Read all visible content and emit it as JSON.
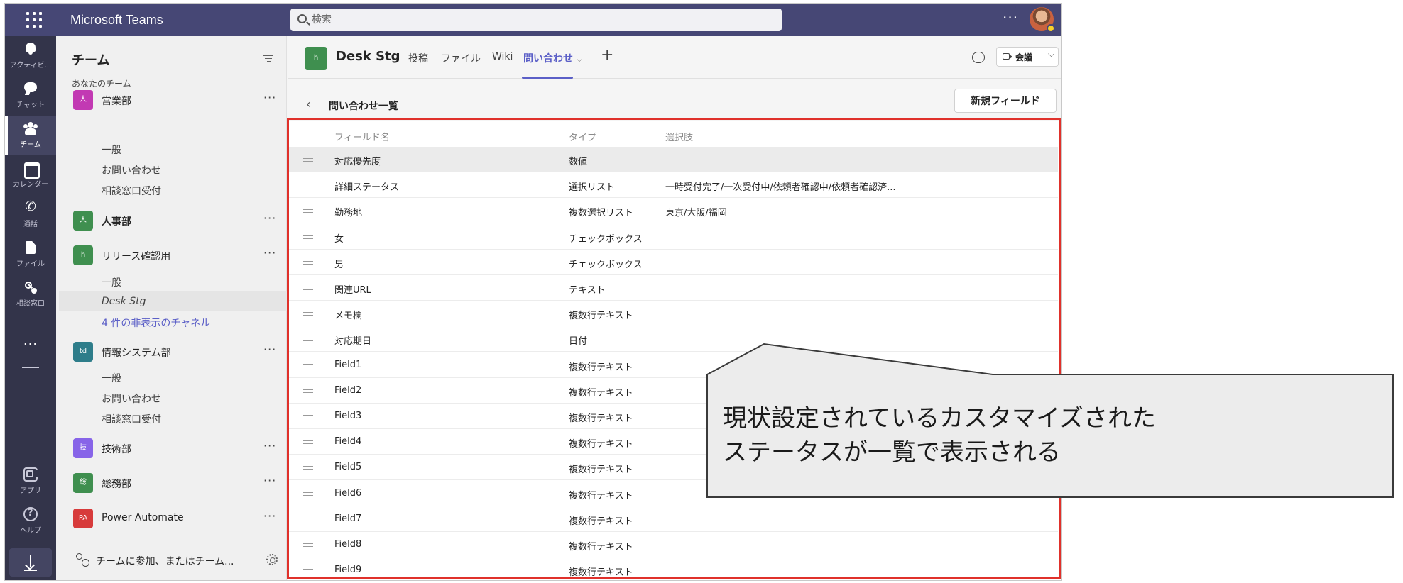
{
  "app": {
    "title": "Microsoft Teams",
    "search_placeholder": "検索",
    "more": "···"
  },
  "rail": {
    "items": [
      {
        "label": "アクティビ..."
      },
      {
        "label": "チャット"
      },
      {
        "label": "チーム"
      },
      {
        "label": "カレンダー"
      },
      {
        "label": "通話"
      },
      {
        "label": "ファイル"
      },
      {
        "label": "相談窓口"
      }
    ],
    "more": "···",
    "apps_label": "アプリ",
    "help_label": "ヘルプ"
  },
  "panel": {
    "title": "チーム",
    "section_label": "あなたのチーム",
    "teams": [
      {
        "tile": "人",
        "color": "#c239b3",
        "name": "営業部",
        "channels": [
          "一般",
          "お問い合わせ",
          "相談窓口受付"
        ]
      },
      {
        "tile": "人",
        "color": "#3f8f4f",
        "name": "人事部",
        "channels": []
      },
      {
        "tile": "h",
        "color": "#3f8f4f",
        "name": "リリース確認用",
        "channels": [
          "一般",
          "Desk Stg"
        ],
        "hidden_channels": "4 件の非表示のチャネル"
      },
      {
        "tile": "td",
        "color": "#2e7d8a",
        "name": "情報システム部",
        "channels": [
          "一般",
          "お問い合わせ",
          "相談窓口受付"
        ]
      },
      {
        "tile": "技",
        "color": "#8764e8",
        "name": "技術部",
        "channels": []
      },
      {
        "tile": "総",
        "color": "#3f8f4f",
        "name": "総務部",
        "channels": []
      },
      {
        "tile": "PA",
        "color": "#d73b3b",
        "name": "Power Automate",
        "channels": []
      }
    ],
    "dots": "···",
    "join_label": "チームに参加、またはチーム..."
  },
  "channel": {
    "tile": "h",
    "title": "Desk Stg",
    "tabs": [
      "投稿",
      "ファイル",
      "Wiki",
      "問い合わせ"
    ],
    "active_tab_chevron": "⌵",
    "add_tab": "+",
    "meet_label": "会議",
    "meet_chevron": "⌵"
  },
  "inquiry": {
    "back": "‹",
    "title": "問い合わせ一覧",
    "new_field_label": "新規フィールド",
    "columns": [
      "フィールド名",
      "タイプ",
      "選択肢"
    ],
    "rows": [
      {
        "name": "対応優先度",
        "type": "数値",
        "options": ""
      },
      {
        "name": "詳細ステータス",
        "type": "選択リスト",
        "options": "一時受付完了/一次受付中/依頼者確認中/依頼者確認済..."
      },
      {
        "name": "勤務地",
        "type": "複数選択リスト",
        "options": "東京/大阪/福岡"
      },
      {
        "name": "女",
        "type": "チェックボックス",
        "options": ""
      },
      {
        "name": "男",
        "type": "チェックボックス",
        "options": ""
      },
      {
        "name": "関連URL",
        "type": "テキスト",
        "options": ""
      },
      {
        "name": "メモ欄",
        "type": "複数行テキスト",
        "options": ""
      },
      {
        "name": "対応期日",
        "type": "日付",
        "options": ""
      },
      {
        "name": "Field1",
        "type": "複数行テキスト",
        "options": ""
      },
      {
        "name": "Field2",
        "type": "複数行テキスト",
        "options": ""
      },
      {
        "name": "Field3",
        "type": "複数行テキスト",
        "options": ""
      },
      {
        "name": "Field4",
        "type": "複数行テキスト",
        "options": ""
      },
      {
        "name": "Field5",
        "type": "複数行テキスト",
        "options": ""
      },
      {
        "name": "Field6",
        "type": "複数行テキスト",
        "options": ""
      },
      {
        "name": "Field7",
        "type": "複数行テキスト",
        "options": ""
      },
      {
        "name": "Field8",
        "type": "複数行テキスト",
        "options": ""
      },
      {
        "name": "Field9",
        "type": "複数行テキスト",
        "options": ""
      }
    ]
  },
  "annotation": {
    "lines": [
      "現状設定されているカスタマイズされた",
      "ステータスが一覧で表示される"
    ],
    "box_color": "#e0312b"
  }
}
